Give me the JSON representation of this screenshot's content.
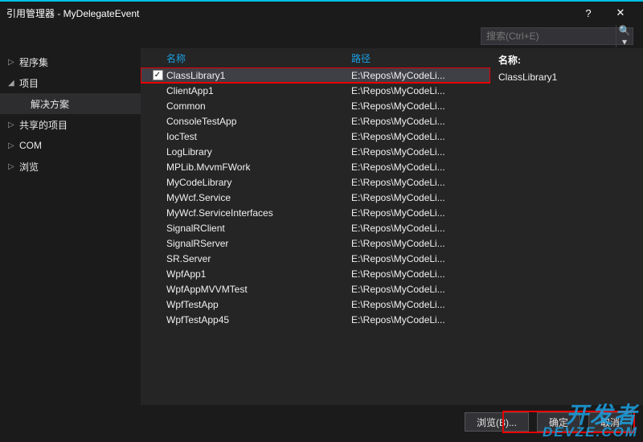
{
  "titlebar": {
    "title": "引用管理器 - MyDelegateEvent",
    "help": "?",
    "close": "✕"
  },
  "search": {
    "placeholder": "搜索(Ctrl+E)"
  },
  "sidebar": {
    "items": [
      {
        "label": "程序集",
        "arrow": "▷"
      },
      {
        "label": "项目",
        "arrow": "◢"
      },
      {
        "label": "解决方案",
        "arrow": "",
        "sub": true
      },
      {
        "label": "共享的项目",
        "arrow": "▷"
      },
      {
        "label": "COM",
        "arrow": "▷"
      },
      {
        "label": "浏览",
        "arrow": "▷"
      }
    ]
  },
  "columns": {
    "name": "名称",
    "path": "路径"
  },
  "rows": [
    {
      "name": "ClassLibrary1",
      "path": "E:\\Repos\\MyCodeLi...",
      "checked": true,
      "selected": true,
      "highlight": true
    },
    {
      "name": "ClientApp1",
      "path": "E:\\Repos\\MyCodeLi..."
    },
    {
      "name": "Common",
      "path": "E:\\Repos\\MyCodeLi..."
    },
    {
      "name": "ConsoleTestApp",
      "path": "E:\\Repos\\MyCodeLi..."
    },
    {
      "name": "IocTest",
      "path": "E:\\Repos\\MyCodeLi..."
    },
    {
      "name": "LogLibrary",
      "path": "E:\\Repos\\MyCodeLi..."
    },
    {
      "name": "MPLib.MvvmFWork",
      "path": "E:\\Repos\\MyCodeLi..."
    },
    {
      "name": "MyCodeLibrary",
      "path": "E:\\Repos\\MyCodeLi..."
    },
    {
      "name": "MyWcf.Service",
      "path": "E:\\Repos\\MyCodeLi..."
    },
    {
      "name": "MyWcf.ServiceInterfaces",
      "path": "E:\\Repos\\MyCodeLi..."
    },
    {
      "name": "SignalRClient",
      "path": "E:\\Repos\\MyCodeLi..."
    },
    {
      "name": "SignalRServer",
      "path": "E:\\Repos\\MyCodeLi..."
    },
    {
      "name": "SR.Server",
      "path": "E:\\Repos\\MyCodeLi..."
    },
    {
      "name": "WpfApp1",
      "path": "E:\\Repos\\MyCodeLi..."
    },
    {
      "name": "WpfAppMVVMTest",
      "path": "E:\\Repos\\MyCodeLi..."
    },
    {
      "name": "WpfTestApp",
      "path": "E:\\Repos\\MyCodeLi..."
    },
    {
      "name": "WpfTestApp45",
      "path": "E:\\Repos\\MyCodeLi..."
    }
  ],
  "details": {
    "label": "名称:",
    "value": "ClassLibrary1"
  },
  "footer": {
    "browse": "浏览(B)...",
    "ok": "确定",
    "cancel": "取消"
  },
  "watermark": {
    "l1": "开发者",
    "l2": "DEVZE.COM"
  }
}
